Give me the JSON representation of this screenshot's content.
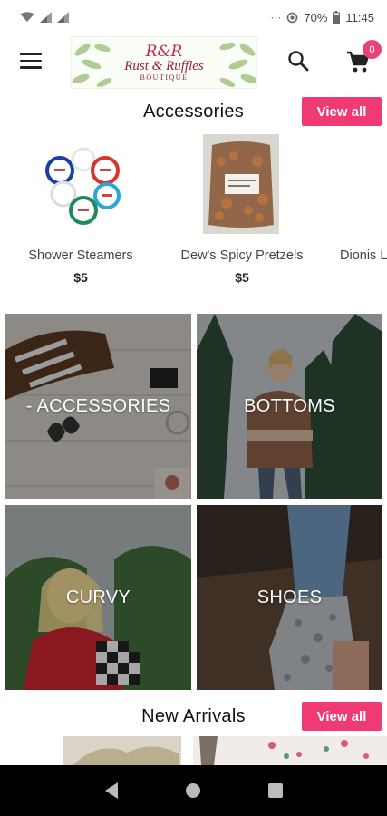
{
  "status_bar": {
    "left_icons": [
      "wifi-icon",
      "signal-icon",
      "signal-icon"
    ],
    "dots": "···",
    "battery_percent": "70%",
    "time": "11:45"
  },
  "app_bar": {
    "logo_monogram": "R&R",
    "logo_name": "Rust & Ruffles",
    "logo_sub": "BOUTIQUE",
    "cart_count": "0"
  },
  "accessories_section": {
    "title": "Accessories",
    "view_all": "View all",
    "products": [
      {
        "name": "Shower Steamers",
        "price": "$5"
      },
      {
        "name": "Dew's Spicy Pretzels",
        "price": "$5"
      },
      {
        "name": "Dionis L",
        "price": ""
      }
    ]
  },
  "categories": [
    {
      "label": "- ACCESSORIES"
    },
    {
      "label": "BOTTOMS"
    },
    {
      "label": "CURVY"
    },
    {
      "label": "SHOES"
    }
  ],
  "new_arrivals_section": {
    "title": "New Arrivals",
    "view_all": "View all"
  },
  "colors": {
    "accent": "#ef3a74",
    "badge": "#e94277",
    "brand": "#9b1c3c"
  }
}
